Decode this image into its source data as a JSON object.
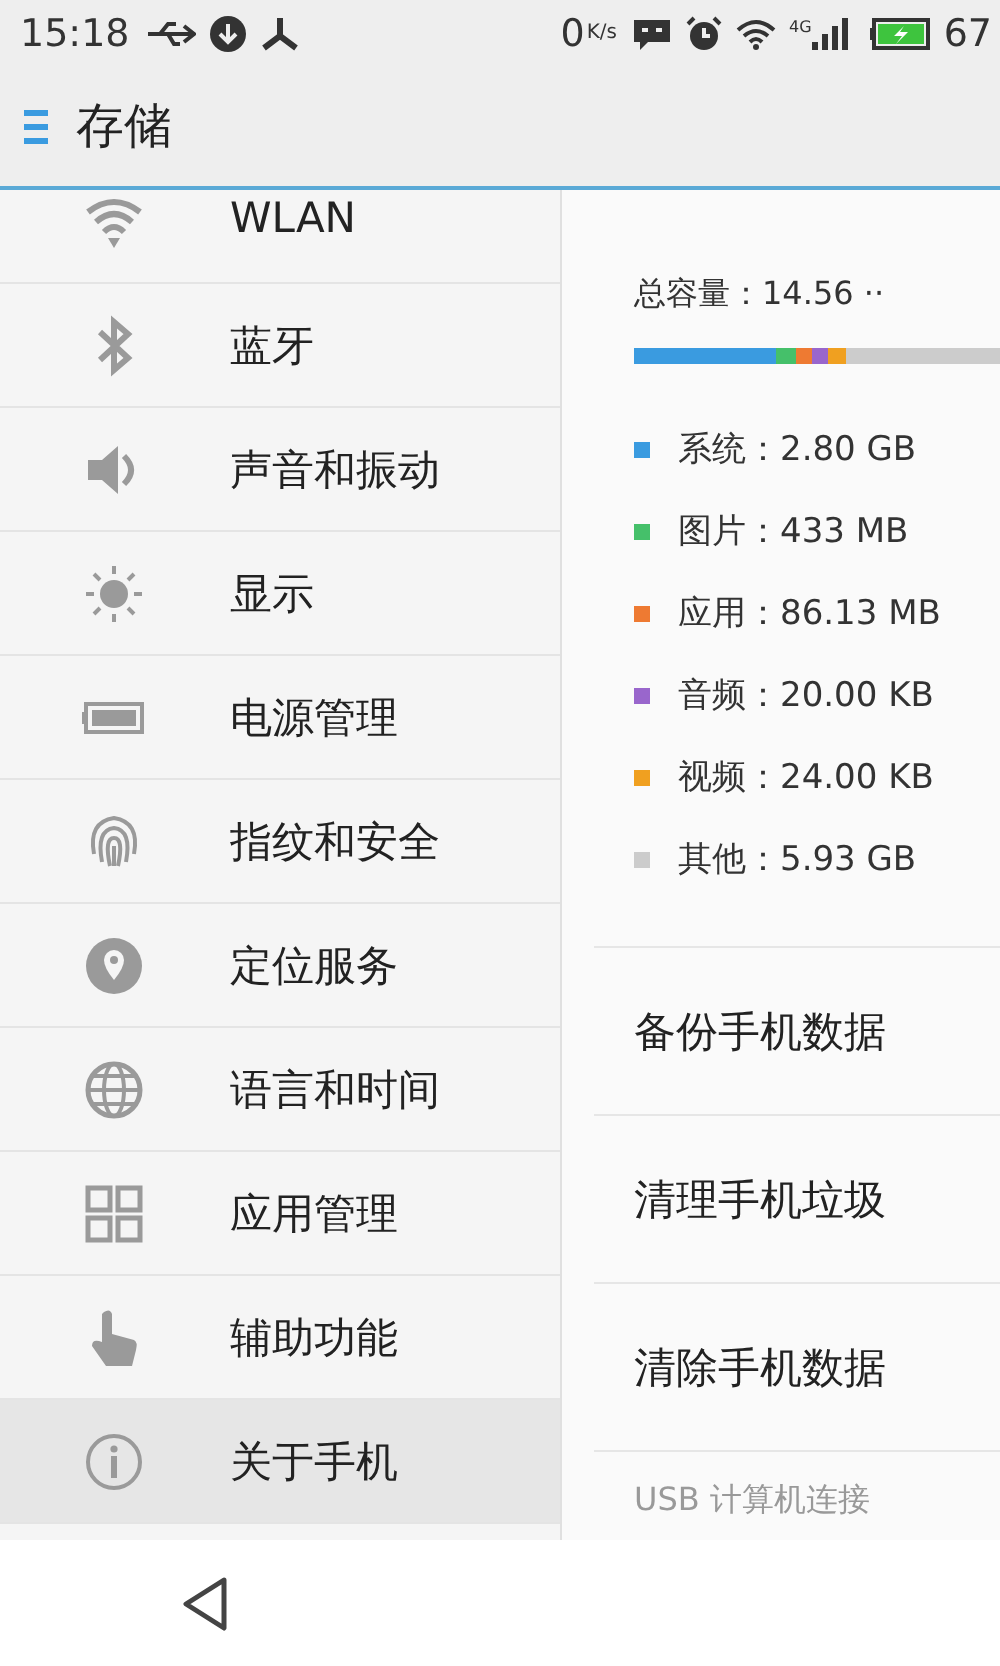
{
  "status_bar": {
    "time": "15:18",
    "speed": "0",
    "speed_unit": "K/s",
    "network": "4G",
    "battery": "67"
  },
  "title_bar": {
    "title": "存储"
  },
  "sidebar": {
    "items": [
      {
        "label": "WLAN",
        "selected": false
      },
      {
        "label": "蓝牙",
        "selected": false
      },
      {
        "label": "声音和振动",
        "selected": false
      },
      {
        "label": "显示",
        "selected": false
      },
      {
        "label": "电源管理",
        "selected": false
      },
      {
        "label": "指纹和安全",
        "selected": false
      },
      {
        "label": "定位服务",
        "selected": false
      },
      {
        "label": "语言和时间",
        "selected": false
      },
      {
        "label": "应用管理",
        "selected": false
      },
      {
        "label": "辅助功能",
        "selected": false
      },
      {
        "label": "关于手机",
        "selected": true
      }
    ]
  },
  "storage": {
    "total": "总容量：14.56 ··",
    "segments": [
      {
        "label": "系统：2.80 GB",
        "color": "#3a9be0",
        "level": 0.39
      },
      {
        "label": "图片：433 MB",
        "color": "#45c06a"
      },
      {
        "label": "应用：86.13 MB",
        "color": "#ee7a32"
      },
      {
        "label": "音频：20.00 KB",
        "color": "#9966cc"
      },
      {
        "label": "视频：24.00 KB",
        "color": "#f0a020"
      },
      {
        "label": "其他：5.93 GB",
        "color": "#cccccc"
      }
    ]
  },
  "actions": [
    "备份手机数据",
    "清理手机垃圾",
    "清除手机数据"
  ],
  "section_header": "USB 计算机连接"
}
